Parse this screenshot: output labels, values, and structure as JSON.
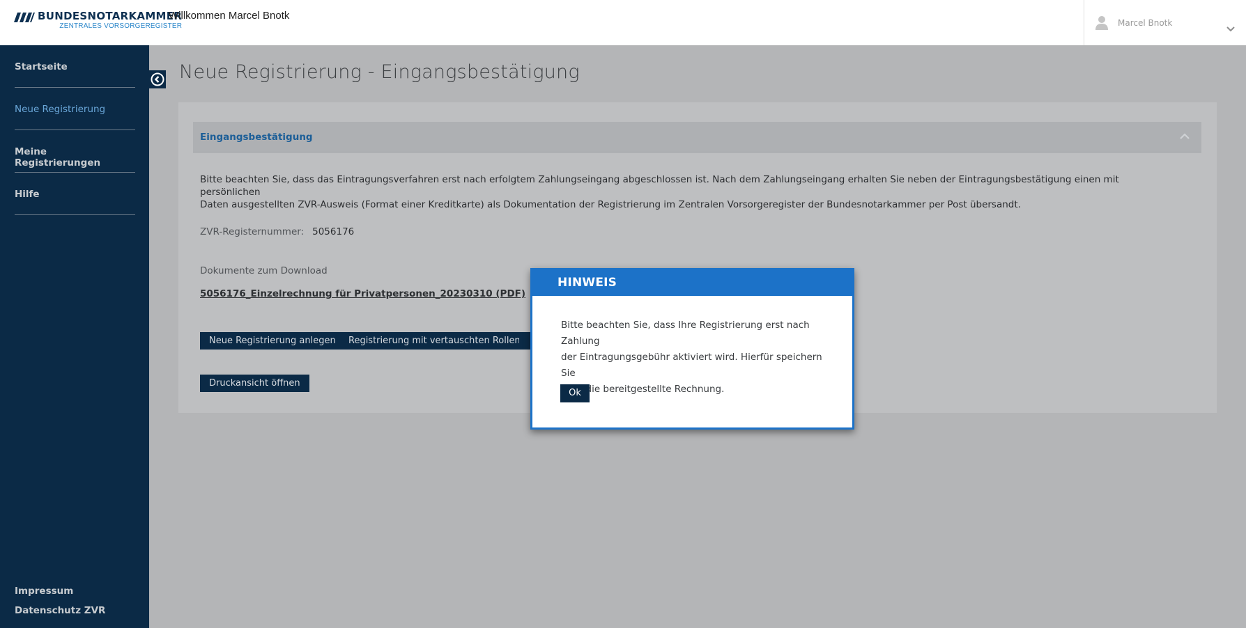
{
  "header": {
    "brand_name": "BUNDESNOTARKAMMER",
    "brand_sub": "ZENTRALES VORSORGEREGISTER",
    "welcome": "Willkommen Marcel Bnotk",
    "user_name": "Marcel Bnotk"
  },
  "sidebar": {
    "items": [
      {
        "label": "Startseite"
      },
      {
        "label": "Neue Registrierung"
      },
      {
        "label": "Meine Registrierungen"
      },
      {
        "label": "Hilfe"
      }
    ],
    "footer": {
      "impressum": "Impressum",
      "datenschutz": "Datenschutz ZVR"
    }
  },
  "main": {
    "title": "Neue Registrierung - Eingangsbestätigung",
    "panel_title": "Eingangsbestätigung",
    "paragraph_line1": "Bitte beachten Sie, dass das Eintragungsverfahren erst nach erfolgtem Zahlungseingang abgeschlossen ist. Nach dem Zahlungseingang erhalten Sie neben der Eintragungsbestätigung einen mit persönlichen",
    "paragraph_line2": "Daten ausgestellten ZVR-Ausweis (Format einer Kreditkarte) als Dokumentation der Registrierung im Zentralen Vorsorgeregister der Bundesnotarkammer per Post übersandt.",
    "reg_label": "ZVR-Registernummer:",
    "reg_value": "5056176",
    "docs_label": "Dokumente zum Download",
    "doc_link": "5056176_Einzelrechnung für Privatpersonen_20230310 (PDF)",
    "buttons": {
      "new_registration": "Neue Registrierung anlegen",
      "swapped_roles": "Registrierung mit vertauschten Rollen",
      "print_view": "Druckansicht öffnen"
    }
  },
  "modal": {
    "title": "HINWEIS",
    "line1": "Bitte beachten Sie, dass Ihre Registrierung erst nach Zahlung",
    "line2": "der Eintragungsgebühr aktiviert wird. Hierfür speichern Sie",
    "line3": "bitte die bereitgestellte Rechnung.",
    "ok_label": "Ok"
  },
  "colors": {
    "sidebar_bg": "#0b2a46",
    "accent_blue": "#1c72c8",
    "active_nav": "#6aa7d9",
    "overlay_bg": "#b4b5b7"
  }
}
